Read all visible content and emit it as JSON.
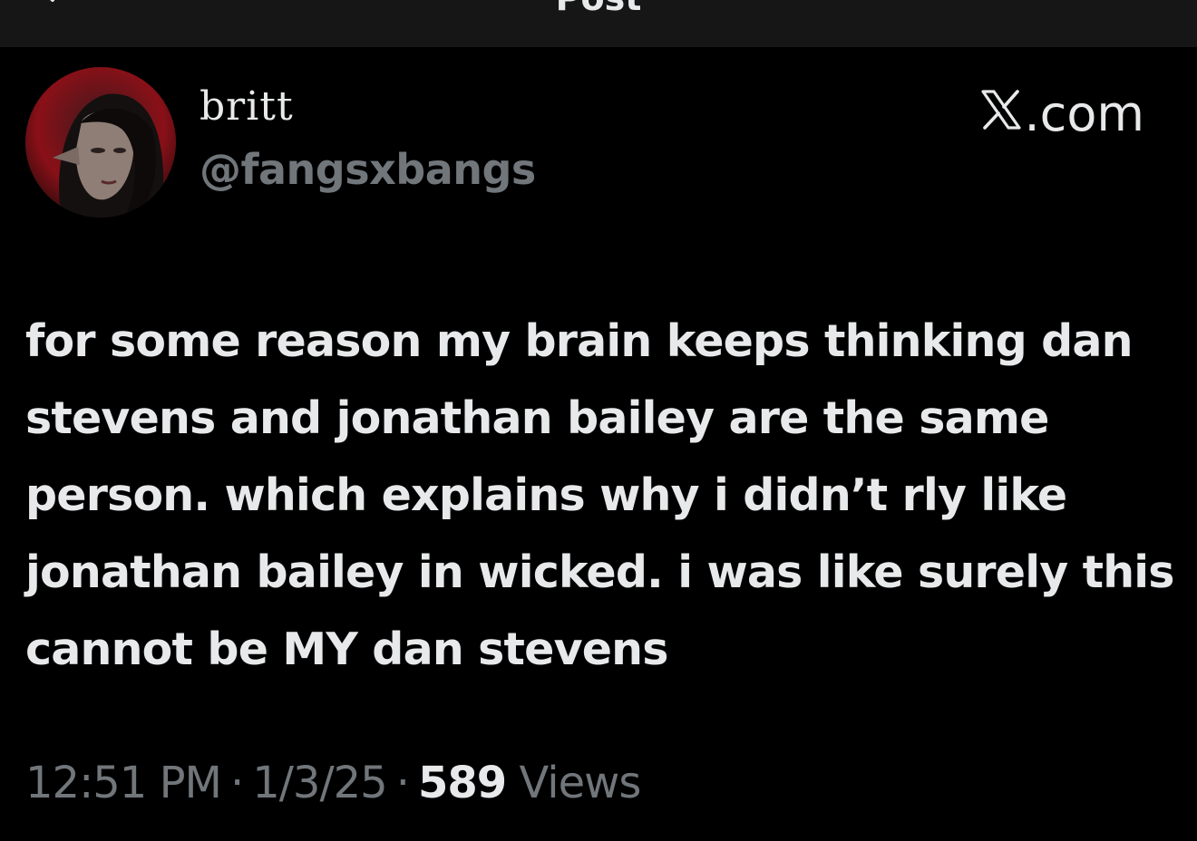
{
  "header": {
    "title": "Post"
  },
  "post": {
    "display_name": "britt",
    "handle": "@fangsxbangs",
    "site": ".com",
    "site_icon": "x-logo-icon",
    "text": "for some reason my brain keeps thinking dan stevens and jonathan bailey are the same person. which explains why i didn’t rly like jonathan bailey in wicked. i was like surely this cannot be MY dan stevens",
    "time": "12:51 PM",
    "date": "1/3/25",
    "separator": "·",
    "views_count": "589",
    "views_label": "Views"
  },
  "colors": {
    "background": "#000000",
    "header_background": "#161616",
    "primary_text": "#e7e9ea",
    "secondary_text": "#71767b",
    "avatar_accent": "#b3121d"
  }
}
